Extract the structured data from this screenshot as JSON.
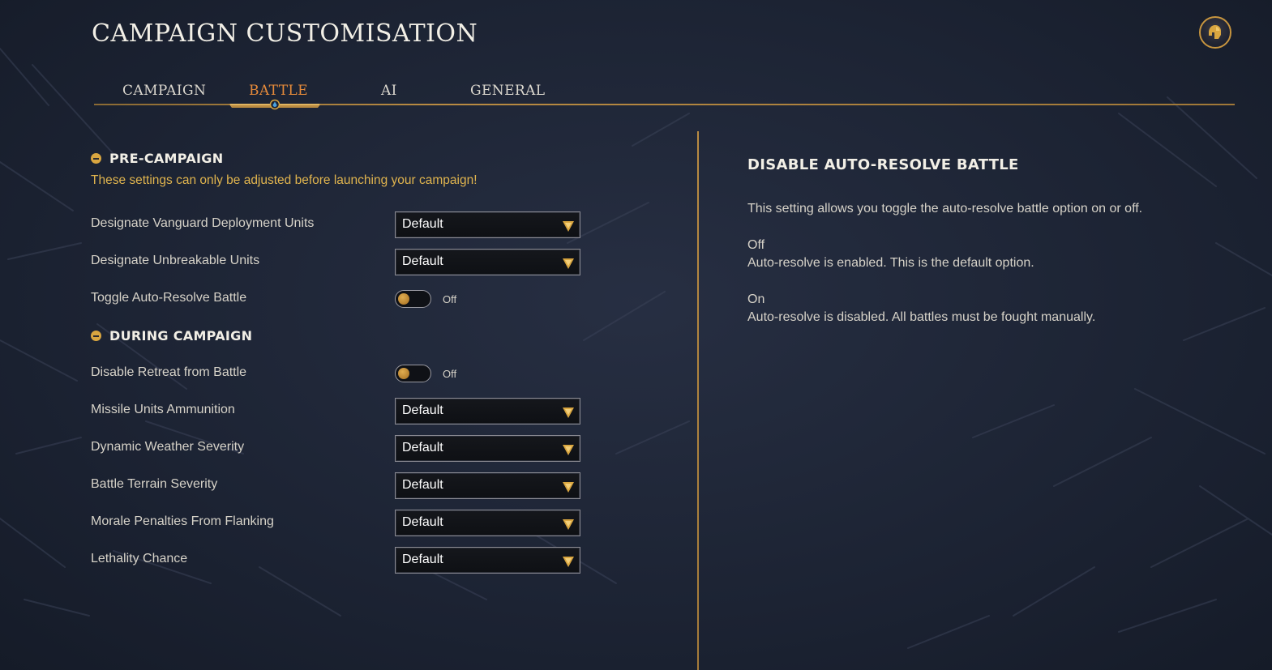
{
  "page": {
    "title": "Campaign Customisation"
  },
  "colors": {
    "accent_gold": "#c7953f",
    "active_tab": "#e58a3a",
    "warning_text": "#e0b44e",
    "background": "#1c2333"
  },
  "header": {
    "icon": "helmet-icon"
  },
  "tabs": [
    {
      "label": "Campaign",
      "active": false
    },
    {
      "label": "Battle",
      "active": true
    },
    {
      "label": "AI",
      "active": false
    },
    {
      "label": "General",
      "active": false
    }
  ],
  "pre_campaign": {
    "heading": "Pre-Campaign",
    "warning": "These settings can only be adjusted before launching your campaign!",
    "settings": [
      {
        "label": "Designate Vanguard Deployment Units",
        "type": "dropdown",
        "value": "Default"
      },
      {
        "label": "Designate Unbreakable Units",
        "type": "dropdown",
        "value": "Default"
      },
      {
        "label": "Toggle Auto-Resolve Battle",
        "type": "toggle",
        "value": "Off"
      }
    ]
  },
  "during_campaign": {
    "heading": "During Campaign",
    "settings": [
      {
        "label": "Disable Retreat from Battle",
        "type": "toggle",
        "value": "Off"
      },
      {
        "label": "Missile Units Ammunition",
        "type": "dropdown",
        "value": "Default"
      },
      {
        "label": "Dynamic Weather Severity",
        "type": "dropdown",
        "value": "Default"
      },
      {
        "label": "Battle Terrain Severity",
        "type": "dropdown",
        "value": "Default"
      },
      {
        "label": "Morale Penalties From Flanking",
        "type": "dropdown",
        "value": "Default"
      },
      {
        "label": "Lethality Chance",
        "type": "dropdown",
        "value": "Default"
      }
    ]
  },
  "info_panel": {
    "title": "Disable Auto-Resolve Battle",
    "description": "This setting allows you toggle the auto-resolve battle option on or off.",
    "options": [
      {
        "name": "Off",
        "text": "Auto-resolve is enabled. This is the default option."
      },
      {
        "name": "On",
        "text": "Auto-resolve is disabled. All battles must be fought manually."
      }
    ]
  }
}
